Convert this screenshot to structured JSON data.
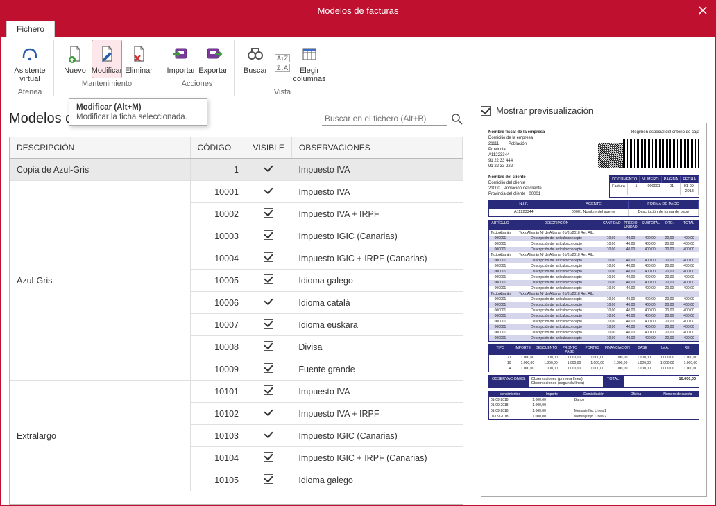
{
  "window": {
    "title": "Modelos de facturas"
  },
  "tab": {
    "fichero": "Fichero"
  },
  "ribbon": {
    "atenea": {
      "asistente": "Asistente virtual",
      "group": "Atenea"
    },
    "mant": {
      "nuevo": "Nuevo",
      "modificar": "Modificar",
      "eliminar": "Eliminar",
      "group": "Mantenimiento"
    },
    "acc": {
      "importar": "Importar",
      "exportar": "Exportar",
      "group": "Acciones"
    },
    "vista": {
      "buscar": "Buscar",
      "elegir": "Elegir columnas",
      "group": "Vista"
    }
  },
  "tooltip": {
    "title": "Modificar (Alt+M)",
    "body": "Modificar la ficha seleccionada."
  },
  "page": {
    "title": "Modelos de facturas",
    "title_truncated": "Modelos d"
  },
  "search": {
    "placeholder": "Buscar en el fichero (Alt+B)"
  },
  "columns": {
    "descripcion": "DESCRIPCIÓN",
    "codigo": "CÓDIGO",
    "visible": "VISIBLE",
    "observaciones": "OBSERVACIONES"
  },
  "rows": [
    {
      "desc": "Copia de Azul-Gris",
      "codigo": "1",
      "visible": true,
      "obs": "Impuesto IVA",
      "selected": true,
      "showDesc": true,
      "rowsInGroup": 1
    },
    {
      "desc": "Azul-Gris",
      "codigo": "10001",
      "visible": true,
      "obs": "Impuesto IVA",
      "showDesc": false,
      "groupStart": true,
      "rowsInGroup": 9
    },
    {
      "desc": "",
      "codigo": "10002",
      "visible": true,
      "obs": "Impuesto IVA + IRPF"
    },
    {
      "desc": "",
      "codigo": "10003",
      "visible": true,
      "obs": "Impuesto IGIC (Canarias)"
    },
    {
      "desc": "",
      "codigo": "10004",
      "visible": true,
      "obs": "Impuesto IGIC + IRPF (Canarias)"
    },
    {
      "desc": "",
      "codigo": "10005",
      "visible": true,
      "obs": "Idioma galego"
    },
    {
      "desc": "",
      "codigo": "10006",
      "visible": true,
      "obs": "Idioma català"
    },
    {
      "desc": "",
      "codigo": "10007",
      "visible": true,
      "obs": "Idioma euskara"
    },
    {
      "desc": "",
      "codigo": "10008",
      "visible": true,
      "obs": "Divisa"
    },
    {
      "desc": "",
      "codigo": "10009",
      "visible": true,
      "obs": "Fuente grande"
    },
    {
      "desc": "Extralargo",
      "codigo": "10101",
      "visible": true,
      "obs": "Impuesto IVA",
      "showDesc": false,
      "groupStart": true,
      "rowsInGroup": 5
    },
    {
      "desc": "",
      "codigo": "10102",
      "visible": true,
      "obs": "Impuesto IVA + IRPF"
    },
    {
      "desc": "",
      "codigo": "10103",
      "visible": true,
      "obs": "Impuesto IGIC (Canarias)"
    },
    {
      "desc": "",
      "codigo": "10104",
      "visible": true,
      "obs": "Impuesto IGIC + IRPF (Canarias)"
    },
    {
      "desc": "",
      "codigo": "10105",
      "visible": true,
      "obs": "Idioma galego"
    }
  ],
  "group_labels": {
    "g1": "Azul-Gris",
    "g2": "Extralargo"
  },
  "preview": {
    "checkbox_label": "Mostrar previsualización",
    "company": {
      "name": "Nombre fiscal de la empresa",
      "dom": "Domicilio de la empresa",
      "cp": "21111",
      "pob": "Población",
      "prov": "Provincia",
      "nif": "A11223344",
      "tel1": "91 22 33 444",
      "tel2": "91 22 33 222",
      "regimen": "Régimen especial del criterio de caja"
    },
    "client": {
      "name": "Nombre del cliente",
      "dom": "Domicilio del cliente",
      "cp": "21000",
      "pob": "Población del cliente",
      "prov": "Provincia del cliente",
      "code": "00001"
    },
    "docinfo": {
      "h": [
        "DOCUMENTO",
        "NÚMERO",
        "PÁGINA",
        "FECHA"
      ],
      "v": [
        "Factura",
        "1",
        "000001",
        "01",
        "01-09-2018"
      ]
    },
    "agent": {
      "h": [
        "N.I.F.",
        "AGENTE",
        "FORMA DE PAGO"
      ],
      "v": [
        "A11223344",
        "00001   Nombre del agente",
        "Descripción de forma de pago"
      ]
    },
    "lines_head": [
      "ARTÍCULO",
      "DESCRIPCIÓN",
      "CANTIDAD",
      "PRECIO UNIDAD",
      "SUBTOTAL",
      "DTO.",
      "TOTAL"
    ],
    "line_sample": {
      "art": "000001",
      "desc": "Descripción del artículo/concepto",
      "text": "TextoAlbarán   Nº de Albarán   01/01/2018   Ref. Alb.",
      "cant": "10,00",
      "pu": "40,00",
      "sub": "400,00",
      "dto": "20,00",
      "tot": "400,00"
    },
    "totals_head": [
      "TIPO",
      "IMPORTE",
      "DESCUENTO",
      "PRONTO PAGO",
      "PORTES",
      "FINANCIACIÓN",
      "BASE",
      "I.V.A.",
      "RE."
    ],
    "totals_rows": [
      [
        "21",
        "1.000,00",
        "1.000,00",
        "1.000,00",
        "1.000,00",
        "1.000,00",
        "1.000,00",
        "1.000,00",
        "1.000,00"
      ],
      [
        "10",
        "1.000,00",
        "1.000,00",
        "1.000,00",
        "1.000,00",
        "1.000,00",
        "1.000,00",
        "1.000,00",
        "1.000,00"
      ],
      [
        "4",
        "1.000,00",
        "1.000,00",
        "1.000,00",
        "1.000,00",
        "1.000,00",
        "1.000,00",
        "1.000,00",
        "1.000,00"
      ]
    ],
    "obs": {
      "label": "OBSERVACIONES:",
      "l1": "Observaciones (primera línea)",
      "l2": "Observaciones (segunda línea)",
      "total_label": "TOTAL:",
      "total": "10.000,00"
    },
    "venc_head": [
      "Vencimientos",
      "Importe",
      "Domiciliación",
      "Oficina",
      "Número de cuenta"
    ],
    "venc_rows": [
      [
        "01-09-2018",
        "1.000,00",
        "Banco",
        "",
        ""
      ],
      [
        "01-09-2018",
        "1.000,00",
        "",
        "",
        ""
      ],
      [
        "01-09-2018",
        "1.000,00",
        "Mensaje fijo. Línea 1",
        "",
        ""
      ],
      [
        "01-09-2018",
        "1.000,00",
        "Mensaje fijo. Línea 2",
        "",
        ""
      ]
    ]
  }
}
